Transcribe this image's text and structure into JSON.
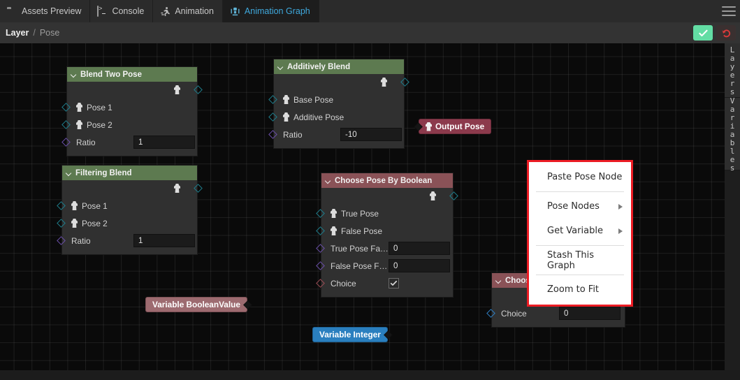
{
  "window": {
    "tabs": [
      {
        "label": "Assets Preview",
        "icon": "folder-icon",
        "active": false
      },
      {
        "label": "Console",
        "icon": "console-icon",
        "active": false
      },
      {
        "label": "Animation",
        "icon": "running-man-icon",
        "active": false
      },
      {
        "label": "Animation Graph",
        "icon": "animation-graph-icon",
        "active": true
      }
    ],
    "menu_icon": "hamburger-icon"
  },
  "breadcrumb": {
    "root": "Layer",
    "separator": "/",
    "leaf": "Pose",
    "confirm_label": "check-icon",
    "revert_label": "revert-icon"
  },
  "dock": {
    "tabs": [
      {
        "label": "Layers"
      },
      {
        "label": "Variables"
      }
    ]
  },
  "graph": {
    "nodes": [
      {
        "id": "blend-two-pose",
        "title": "Blend Two Pose",
        "header_color": "#5d7a50",
        "inputs": [
          {
            "label": "Pose 1",
            "port": "teal",
            "kind": "pose"
          },
          {
            "label": "Pose 2",
            "port": "teal",
            "kind": "pose"
          },
          {
            "label": "Ratio",
            "port": "purple",
            "kind": "value",
            "value": "1"
          }
        ]
      },
      {
        "id": "filtering-blend",
        "title": "Filtering Blend",
        "header_color": "#5d7a50",
        "inputs": [
          {
            "label": "Pose 1",
            "port": "teal",
            "kind": "pose"
          },
          {
            "label": "Pose 2",
            "port": "teal",
            "kind": "pose"
          },
          {
            "label": "Ratio",
            "port": "purple",
            "kind": "value",
            "value": "1"
          }
        ]
      },
      {
        "id": "additively-blend",
        "title": "Additively Blend",
        "header_color": "#5d7a50",
        "inputs": [
          {
            "label": "Base Pose",
            "port": "teal",
            "kind": "pose"
          },
          {
            "label": "Additive Pose",
            "port": "teal",
            "kind": "pose"
          },
          {
            "label": "Ratio",
            "port": "purple",
            "kind": "value",
            "value": "-10"
          }
        ]
      },
      {
        "id": "choose-pose-by-boolean",
        "title": "Choose Pose By Boolean",
        "header_color": "#8a5257",
        "inputs": [
          {
            "label": "True Pose",
            "port": "teal",
            "kind": "pose"
          },
          {
            "label": "False Pose",
            "port": "teal",
            "kind": "pose"
          },
          {
            "label": "True Pose Fa…",
            "port": "purple",
            "kind": "value",
            "value": "0"
          },
          {
            "label": "False Pose F…",
            "port": "purple",
            "kind": "value",
            "value": "0"
          },
          {
            "label": "Choice",
            "port": "pink",
            "kind": "checkbox",
            "checked": true
          }
        ]
      },
      {
        "id": "choose-pose-by-index",
        "title": "Choose Pose By Index",
        "header_color": "#8a5257",
        "add_label": "+",
        "inputs": [
          {
            "label": "Choice",
            "port": "blue",
            "kind": "value",
            "value": "0"
          }
        ]
      }
    ],
    "pills": [
      {
        "id": "output-pose",
        "label": "Output Pose",
        "style": "crimson",
        "icon": "pose-icon"
      },
      {
        "id": "variable-booleanvalue",
        "label": "Variable BooleanValue",
        "style": "mauve"
      },
      {
        "id": "variable-integer",
        "label": "Variable Integer",
        "style": "blue"
      }
    ]
  },
  "context_menu": {
    "highlight_color": "#ec1c24",
    "items": [
      {
        "label": "Paste Pose Node",
        "submenu": false
      },
      {
        "label": "Pose Nodes",
        "submenu": true
      },
      {
        "label": "Get Variable",
        "submenu": true
      },
      {
        "label": "Stash This Graph",
        "submenu": false
      },
      {
        "label": "Zoom to Fit",
        "submenu": false
      }
    ]
  }
}
